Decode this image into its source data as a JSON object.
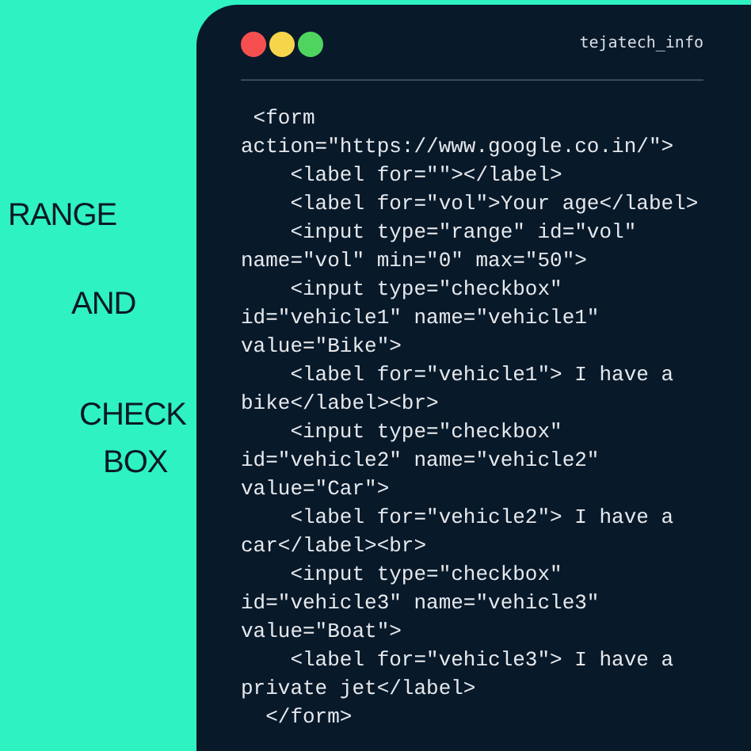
{
  "headline": [
    "RANGE",
    "AND",
    "CHECK",
    "BOX"
  ],
  "window": {
    "controls": [
      {
        "color": "#f5504f"
      },
      {
        "color": "#f7d54a"
      },
      {
        "color": "#4fd460"
      }
    ],
    "handle": "tejatech_info"
  },
  "code_lines": [
    " <form",
    "action=\"https://www.google.co.in/\">",
    "    <label for=\"\"></label>",
    "    <label for=\"vol\">Your age</label>",
    "    <input type=\"range\" id=\"vol\"",
    "name=\"vol\" min=\"0\" max=\"50\">",
    "    <input type=\"checkbox\"",
    "id=\"vehicle1\" name=\"vehicle1\"",
    "value=\"Bike\">",
    "    <label for=\"vehicle1\"> I have a",
    "bike</label><br>",
    "    <input type=\"checkbox\"",
    "id=\"vehicle2\" name=\"vehicle2\"",
    "value=\"Car\">",
    "    <label for=\"vehicle2\"> I have a",
    "car</label><br>",
    "    <input type=\"checkbox\"",
    "id=\"vehicle3\" name=\"vehicle3\"",
    "value=\"Boat\">",
    "    <label for=\"vehicle3\"> I have a",
    "private jet</label>",
    "  </form>"
  ]
}
